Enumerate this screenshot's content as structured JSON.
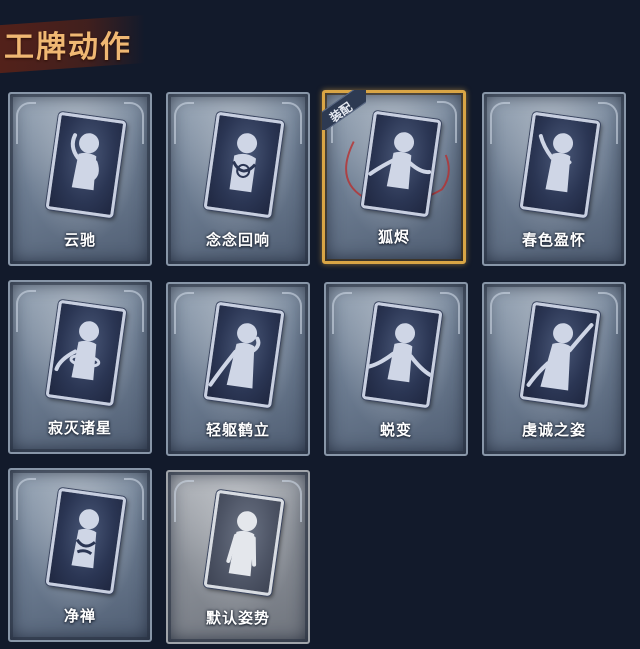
{
  "header": {
    "title": "工牌动作"
  },
  "cards": [
    {
      "label": "云驰",
      "equipped": false,
      "dim": false
    },
    {
      "label": "念念回响",
      "equipped": false,
      "dim": false
    },
    {
      "label": "狐烬",
      "equipped": true,
      "dim": false,
      "badge": "装配"
    },
    {
      "label": "春色盈怀",
      "equipped": false,
      "dim": false
    },
    {
      "label": "寂灭诸星",
      "equipped": false,
      "dim": false
    },
    {
      "label": "轻躯鹤立",
      "equipped": false,
      "dim": false
    },
    {
      "label": "蜕变",
      "equipped": false,
      "dim": false
    },
    {
      "label": "虔诚之姿",
      "equipped": false,
      "dim": false
    },
    {
      "label": "净禅",
      "equipped": false,
      "dim": false
    },
    {
      "label": "默认姿势",
      "equipped": false,
      "dim": true
    }
  ],
  "colors": {
    "background": "#121a2b",
    "title": "#f0b873",
    "equipped_border": "#d9a545"
  }
}
